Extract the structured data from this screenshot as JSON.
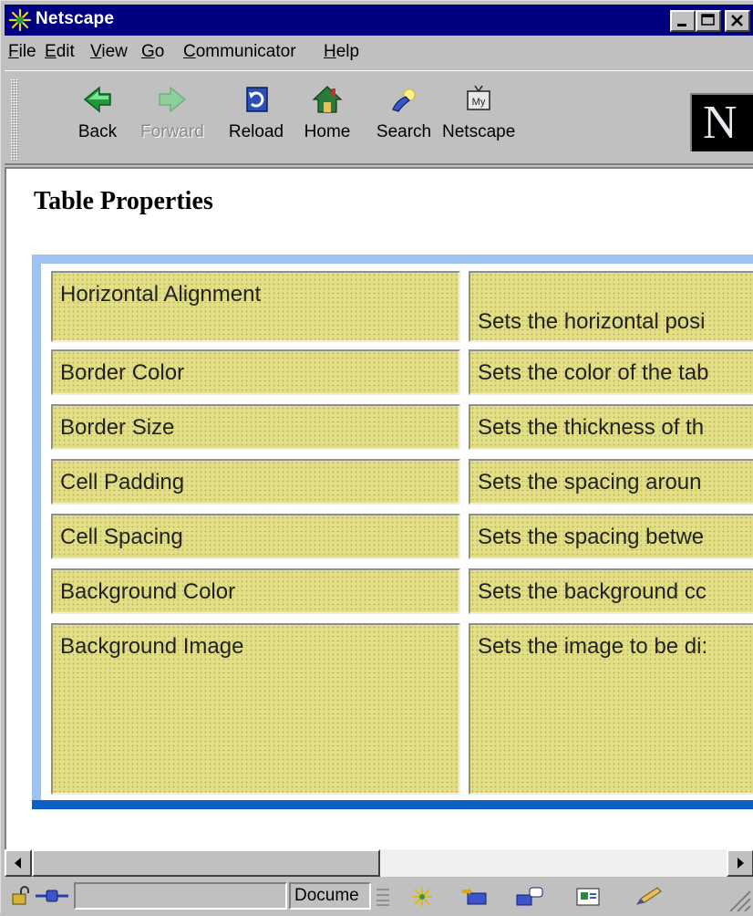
{
  "window": {
    "title": "Netscape"
  },
  "menu": [
    {
      "label": "File"
    },
    {
      "label": "Edit"
    },
    {
      "label": "View"
    },
    {
      "label": "Go"
    },
    {
      "label": "Communicator"
    },
    {
      "label": "Help"
    }
  ],
  "toolbar": {
    "back": "Back",
    "forward": "Forward",
    "reload": "Reload",
    "home": "Home",
    "search": "Search",
    "netscape": "Netscape",
    "my_badge": "My",
    "throbber_letter": "N"
  },
  "page": {
    "title": "Table Properties",
    "rows": [
      {
        "property": "Horizontal Alignment",
        "description": "Sets the horizontal posi"
      },
      {
        "property": "Border Color",
        "description": "Sets the color of the tab"
      },
      {
        "property": "Border Size",
        "description": "Sets the thickness of th"
      },
      {
        "property": "Cell Padding",
        "description": "Sets the spacing aroun"
      },
      {
        "property": "Cell Spacing",
        "description": "Sets the spacing betwe"
      },
      {
        "property": "Background Color",
        "description": "Sets the background cc"
      },
      {
        "property": "Background Image",
        "description": "Sets the image to be di:"
      }
    ]
  },
  "status": {
    "text": "Docume"
  },
  "colors": {
    "titlebar": "#000080",
    "cell_bg": "#e2df86",
    "table_border_dark": "#0d5fc4",
    "table_border_light": "#9cc3f1"
  }
}
